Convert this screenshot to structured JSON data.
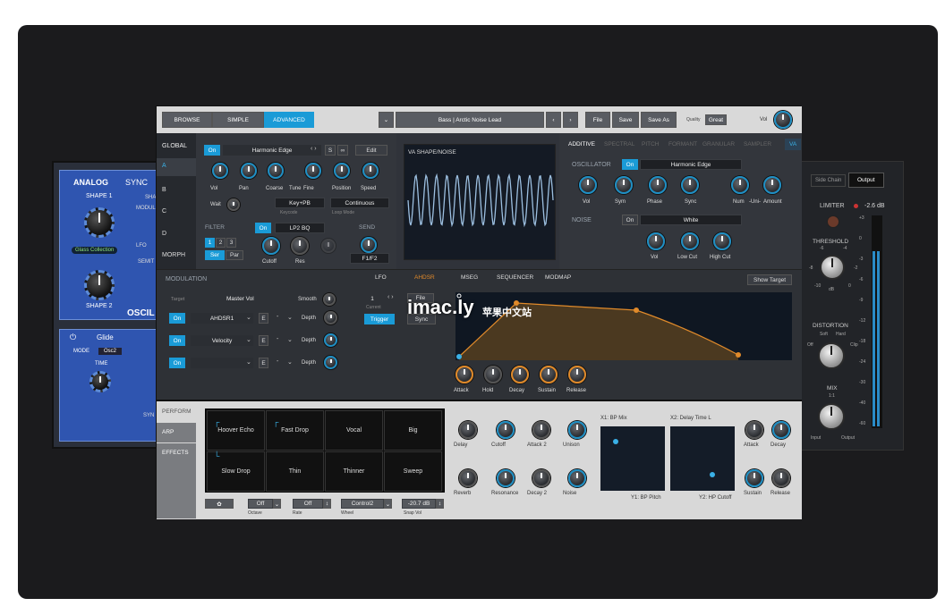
{
  "topbar": {
    "browse": "BROWSE",
    "simple": "SIMPLE",
    "advanced": "ADVANCED",
    "patch": "Bass | Arctic Noise Lead",
    "file": "File",
    "save": "Save",
    "save_as": "Save As",
    "quality_label": "Quality",
    "quality": "Great",
    "vol": "Vol"
  },
  "left_panel": {
    "analog": "ANALOG",
    "sync": "SYNC",
    "shape1": "SHAPE 1",
    "shape2": "SHAPE 2",
    "glass": "Glass Collection",
    "osc": "OSCIL",
    "glide": "Glide",
    "mode": "MODE",
    "mode_val": "Osc2",
    "time": "TIME",
    "frag1": "SHA",
    "frag2": "MODUL",
    "frag3": "LFO",
    "frag4": "SEMIT",
    "frag5": "SYN"
  },
  "right_panel": {
    "side_chain": "Side Chain",
    "output": "Output",
    "limiter": "LIMITER",
    "limiter_val": "-2.6 dB",
    "threshold": "THRESHOLD",
    "distortion": "DISTORTION",
    "soft": "Soft",
    "hard": "Hard",
    "off": "Off",
    "clip": "Clip",
    "mix": "MIX",
    "mix_ratio": "1:1",
    "input": "Input",
    "output_lbl": "Output",
    "db": "dB",
    "t_m6": "-6",
    "t_m4": "-4",
    "t_m8": "-8",
    "t_m2": "-2",
    "t_m10": "-10",
    "t_0": "0",
    "scale": [
      "+3",
      "0",
      "-3",
      "-6",
      "-9",
      "-12",
      "-18",
      "-24",
      "-30",
      "-40",
      "-60"
    ]
  },
  "global": {
    "title": "GLOBAL",
    "layers": [
      "A",
      "B",
      "C",
      "D",
      "MORPH"
    ],
    "on": "On",
    "osc_name": "Harmonic Edge",
    "s": "S",
    "edit": "Edit",
    "knobs": [
      "Vol",
      "Pan",
      "Coarse",
      "Tune",
      "Fine",
      "Position",
      "Speed"
    ],
    "wait": "Wait",
    "keymode": "Key+PB",
    "keycode_lbl": "Keycode",
    "loopmode": "Continuous",
    "loopmode_lbl": "Loop Mode",
    "filter": "FILTER",
    "filter_on": "On",
    "filter_type": "LP2 BQ",
    "send": "SEND",
    "n1": "1",
    "n2": "2",
    "n3": "3",
    "ser": "Ser",
    "par": "Par",
    "cutoff": "Cutoff",
    "res": "Res",
    "send_val": "F1/F2"
  },
  "va": {
    "title": "VA SHAPE/NOISE"
  },
  "additive": {
    "tabs": [
      "ADDITIVE",
      "SPECTRAL",
      "PITCH",
      "FORMANT",
      "GRANULAR",
      "SAMPLER",
      "VA"
    ],
    "oscillator": "OSCILLATOR",
    "on": "On",
    "osc_name": "Harmonic Edge",
    "knobs": [
      "Vol",
      "Sym",
      "Phase",
      "Sync",
      "Num",
      "-Uni-",
      "Amount"
    ],
    "noise": "NOISE",
    "noise_on": "On",
    "noise_type": "White",
    "noise_knobs": [
      "Vol",
      "Low Cut",
      "High Cut"
    ]
  },
  "modulation": {
    "title": "MODULATION",
    "target": "Target",
    "target_val": "Master Vol",
    "smooth": "Smooth",
    "rows": [
      {
        "on": "On",
        "src": "AHDSR1",
        "e": "E",
        "dash": "-",
        "depth": "Depth"
      },
      {
        "on": "On",
        "src": "Velocity",
        "e": "E",
        "dash": "-",
        "depth": "Depth"
      },
      {
        "on": "On",
        "src": "",
        "e": "E",
        "dash": "-",
        "depth": "Depth"
      }
    ]
  },
  "env": {
    "tabs": [
      "LFO",
      "AHDSR",
      "MSEG",
      "SEQUENCER",
      "MODMAP"
    ],
    "show_target": "Show Target",
    "num": "1",
    "current": "Current",
    "file": "File",
    "trigger": "Trigger",
    "sync": "Sync",
    "knobs": [
      "Attack",
      "Hold",
      "Decay",
      "Sustain",
      "Release"
    ]
  },
  "watermark": {
    "brand": "imac.ly",
    "cn": "苹果中文站"
  },
  "perform": {
    "tabs": [
      "PERFORM",
      "ARP",
      "EFFECTS"
    ],
    "pads": [
      "Hoover Echo",
      "Fast Drop",
      "Vocal",
      "Big",
      "Slow Drop",
      "Thin",
      "Thinner",
      "Sweep"
    ],
    "octave": "Off",
    "octave_lbl": "Octave",
    "rate": "Off",
    "rate_lbl": "Rate",
    "wheel": "Control2",
    "wheel_lbl": "Wheel",
    "snap": "-20.7 dB",
    "snap_lbl": "Snap Vol",
    "knobs": [
      "Delay",
      "Cutoff",
      "Attack 2",
      "Unison",
      "Reverb",
      "Resonance",
      "Decay 2",
      "Noise"
    ],
    "x1": "X1: BP Mix",
    "x2": "X2: Delay Time L",
    "y1": "Y1: BP Pitch",
    "y2": "Y2: HP Cutoff",
    "right_knobs": [
      "Attack",
      "Decay",
      "Sustain",
      "Release"
    ]
  }
}
